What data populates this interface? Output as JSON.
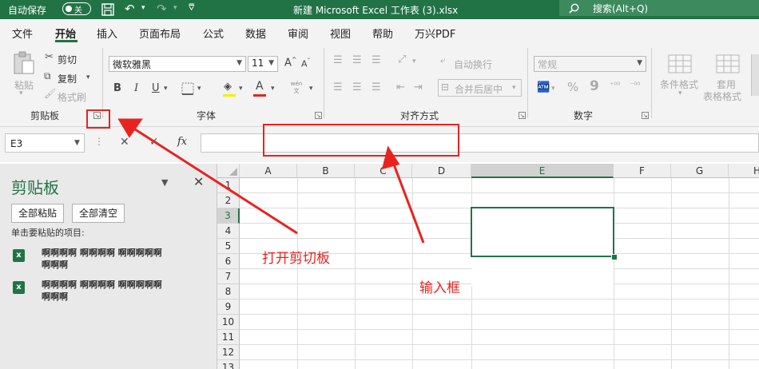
{
  "titlebar": {
    "autosave_label": "自动保存",
    "autosave_state": "关",
    "doc_title": "新建 Microsoft Excel 工作表 (3).xlsx",
    "search_placeholder": "搜索(Alt+Q)"
  },
  "menu": {
    "tabs": [
      "文件",
      "开始",
      "插入",
      "页面布局",
      "公式",
      "数据",
      "审阅",
      "视图",
      "帮助",
      "万兴PDF"
    ],
    "active_tab": "开始"
  },
  "ribbon": {
    "clipboard": {
      "group": "剪贴板",
      "paste": "粘贴",
      "cut": "剪切",
      "copy": "复制",
      "format_painter": "格式刷"
    },
    "font": {
      "group": "字体",
      "font_name": "微软雅黑",
      "font_size": "11",
      "bold": "B",
      "italic": "I",
      "underline": "U",
      "font_color": "A",
      "phonetic": "wén 文"
    },
    "alignment": {
      "group": "对齐方式",
      "wrap_text": "自动换行",
      "merge_center": "合并后居中"
    },
    "number": {
      "group": "数字",
      "format": "常规",
      "percent": "%",
      "comma": "9"
    },
    "styles": {
      "conditional": "条件格式",
      "table_line1": "套用",
      "table_line2": "表格格式"
    }
  },
  "formula_bar": {
    "name_box": "E3",
    "fx": "fx",
    "cancel": "✕",
    "enter": "✓"
  },
  "clipboard_pane": {
    "title": "剪贴板",
    "paste_all": "全部粘贴",
    "clear_all": "全部清空",
    "instructions": "单击要粘贴的项目:",
    "items": [
      {
        "line1": "啊啊啊啊 啊啊啊啊 啊啊啊啊啊",
        "line2": "啊啊啊"
      },
      {
        "line1": "啊啊啊啊 啊啊啊啊 啊啊啊啊啊",
        "line2": "啊啊啊"
      }
    ]
  },
  "sheet": {
    "columns": [
      "A",
      "B",
      "C",
      "D",
      "E",
      "F",
      "G",
      "H"
    ],
    "rows": [
      "1",
      "2",
      "3",
      "4",
      "5",
      "6",
      "7",
      "8",
      "9",
      "10",
      "11",
      "12",
      "13"
    ],
    "selected_cell": "E3",
    "accent": "#217346"
  },
  "annotations": {
    "open_clipboard": "打开剪切板",
    "input_box": "输入框",
    "color": "#e8231f"
  }
}
